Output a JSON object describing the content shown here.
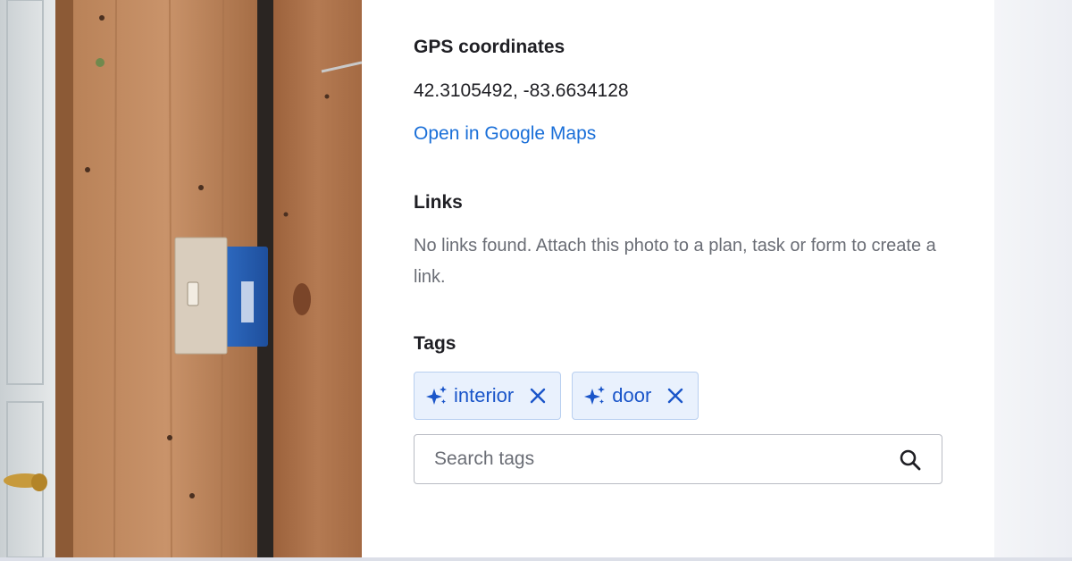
{
  "details": {
    "gps": {
      "title": "GPS coordinates",
      "value": "42.3105492, -83.6634128",
      "map_link": "Open in Google Maps"
    },
    "links": {
      "title": "Links",
      "empty_message": "No links found. Attach this photo to a plan, task or form to create a link."
    },
    "tags": {
      "title": "Tags",
      "items": [
        {
          "label": "interior",
          "icon": "ai-sparkle-icon",
          "remove_icon": "close-icon"
        },
        {
          "label": "door",
          "icon": "ai-sparkle-icon",
          "remove_icon": "close-icon"
        }
      ],
      "search_placeholder": "Search tags"
    }
  },
  "colors": {
    "link": "#1a6fd8",
    "tag_bg": "#e9f1fd",
    "tag_border": "#b8cff0",
    "tag_text": "#1a55c9"
  }
}
